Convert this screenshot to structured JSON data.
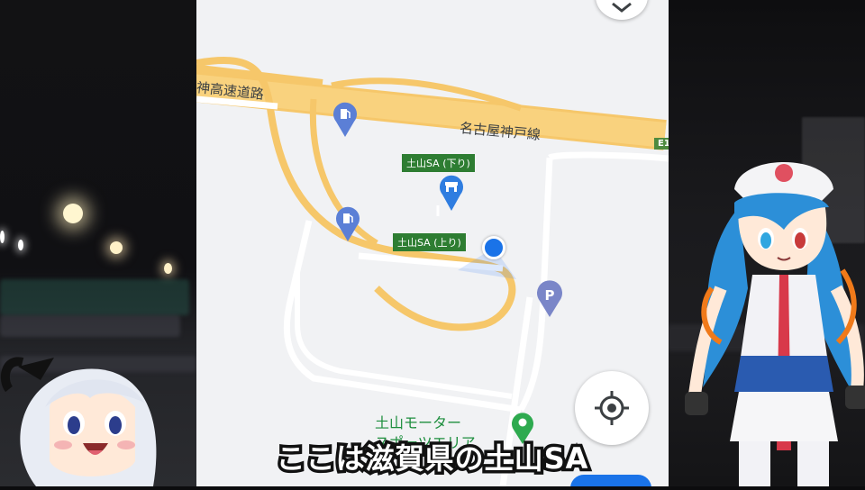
{
  "map": {
    "expressway_left_label": "神高速道路",
    "expressway_right_label": "名古屋神戸線",
    "route_shield": "E1",
    "places": {
      "sa_down": "土山SA (下り)",
      "sa_up": "土山SA (上り)",
      "motor_area": "土山モーター\nスポーツエリア"
    }
  },
  "subtitle": "ここは滋賀県の土山SA",
  "colors": {
    "map_bg": "#f1f2f4",
    "expressway": "#f6c76a",
    "road": "#ffffff",
    "poi_blue": "#5b7fd6",
    "place_tag": "#2e7d32",
    "location_dot": "#1a73e8",
    "parking": "#7a86c8"
  },
  "icons": {
    "fuel_1": "gas-station-icon",
    "fuel_2": "gas-station-icon",
    "service_area": "service-area-icon",
    "parking": "parking-icon",
    "motor_area": "place-pin-icon",
    "locate": "my-location-icon"
  }
}
